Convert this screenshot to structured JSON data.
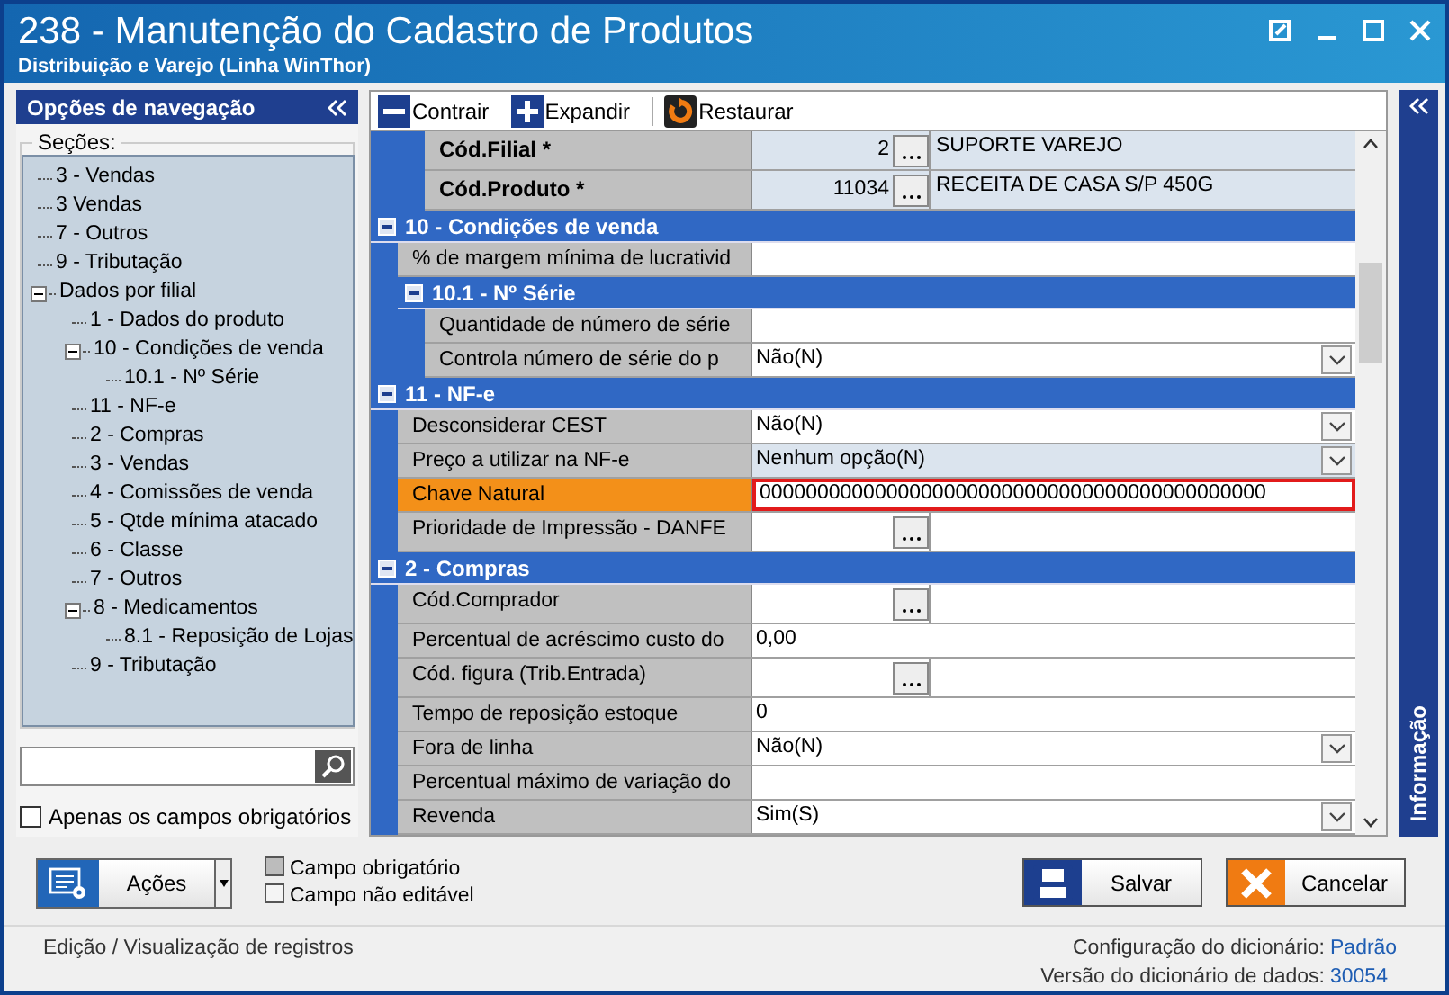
{
  "window": {
    "title": "238 - Manutenção do Cadastro de Produtos",
    "subtitle": "Distribuição e Varejo (Linha WinThor)"
  },
  "navigation": {
    "title": "Opções de navegação",
    "sections_label": "Seções:",
    "tree": [
      {
        "label": "3 - Vendas"
      },
      {
        "label": "3 Vendas"
      },
      {
        "label": "7 - Outros"
      },
      {
        "label": "9 - Tributação"
      },
      {
        "label": "Dados por filial",
        "expanded": true,
        "children": [
          {
            "label": "1 - Dados do produto"
          },
          {
            "label": "10 - Condições de venda",
            "expanded": true,
            "children": [
              {
                "label": "10.1 - Nº Série"
              }
            ]
          },
          {
            "label": "11 - NF-e"
          },
          {
            "label": "2 - Compras"
          },
          {
            "label": "3 - Vendas"
          },
          {
            "label": "4 - Comissões de venda"
          },
          {
            "label": "5 - Qtde mínima atacado"
          },
          {
            "label": "6 - Classe"
          },
          {
            "label": "7 - Outros"
          },
          {
            "label": "8 - Medicamentos",
            "expanded": true,
            "children": [
              {
                "label": "8.1 -  Reposição de Lojas"
              }
            ]
          },
          {
            "label": "9 - Tributação"
          }
        ]
      }
    ],
    "required_only": {
      "label": "Apenas os campos obrigatórios",
      "checked": false
    }
  },
  "toolbar": [
    {
      "kind": "collapse",
      "label": "Contrair"
    },
    {
      "kind": "expand",
      "label": "Expandir"
    },
    {
      "kind": "restore",
      "label": "Restaurar"
    }
  ],
  "grid": {
    "top_rows": [
      {
        "kind": "lookup",
        "label": "Cód.Filial *",
        "code": "2",
        "description": "SUPORTE VAREJO",
        "required": true,
        "editable": false,
        "selected": false
      },
      {
        "kind": "lookup",
        "label": "Cód.Produto *",
        "code": "11034",
        "description": "RECEITA DE CASA S/P 450G",
        "required": true,
        "editable": false,
        "selected": false
      }
    ],
    "sections": [
      {
        "title": "10 - Condições de venda",
        "expanded": true,
        "rows": [
          {
            "kind": "text",
            "label": "% de margem mínima de lucrativid",
            "required": false,
            "editable": true,
            "selected": false
          }
        ],
        "children": [
          {
            "title": "10.1 - Nº Série",
            "expanded": true,
            "rows": [
              {
                "kind": "text",
                "label": "Quantidade de número de série",
                "required": false,
                "editable": true,
                "selected": false
              },
              {
                "kind": "select",
                "label": "Controla número de série do p",
                "value": "Não(N)",
                "required": false,
                "editable": true,
                "selected": false
              }
            ]
          }
        ]
      },
      {
        "title": "11 - NF-e",
        "expanded": true,
        "rows": [
          {
            "kind": "select",
            "label": "Desconsiderar CEST",
            "value": "Não(N)",
            "required": false,
            "editable": true,
            "selected": false
          },
          {
            "kind": "select",
            "label": "Preço a utilizar na NF-e",
            "value": "Nenhum opção(N)",
            "required": false,
            "editable": false,
            "selected": false
          },
          {
            "kind": "text",
            "label": "Chave Natural",
            "value": "00000000000000000000000000000000000000000000",
            "required": false,
            "editable": true,
            "selected": true
          },
          {
            "kind": "lookup",
            "label": "Prioridade de Impressão - DANFE",
            "required": false,
            "editable": true,
            "selected": false
          }
        ]
      },
      {
        "title": "2 - Compras",
        "expanded": true,
        "rows": [
          {
            "kind": "lookup",
            "label": "Cód.Comprador",
            "required": false,
            "editable": true,
            "selected": false
          },
          {
            "kind": "text",
            "label": "Percentual de acréscimo custo do",
            "value": "0,00",
            "required": false,
            "editable": true,
            "selected": false
          },
          {
            "kind": "lookup",
            "label": "Cód. figura (Trib.Entrada)",
            "required": false,
            "editable": true,
            "selected": false
          },
          {
            "kind": "text",
            "label": "Tempo de reposição estoque",
            "value": "0",
            "required": false,
            "editable": true,
            "selected": false
          },
          {
            "kind": "select",
            "label": "Fora de linha",
            "value": "Não(N)",
            "required": false,
            "editable": true,
            "selected": false
          },
          {
            "kind": "text",
            "label": "Percentual máximo de variação do",
            "required": false,
            "editable": true,
            "selected": false
          },
          {
            "kind": "select",
            "label": "Revenda",
            "value": "Sim(S)",
            "required": false,
            "editable": true,
            "selected": false
          }
        ]
      }
    ]
  },
  "info_panel": {
    "title": "Informação"
  },
  "actions_button": {
    "label": "Ações"
  },
  "legend": [
    {
      "label": "Campo obrigatório",
      "color": "#bcbcbc"
    },
    {
      "label": "Campo não editável",
      "color": "#f4f4f4"
    }
  ],
  "buttons": [
    {
      "kind": "save",
      "label": "Salvar"
    },
    {
      "kind": "cancel",
      "label": "Cancelar"
    }
  ],
  "status_bar": {
    "mode": "Edição / Visualização de registros",
    "fields": [
      {
        "label": "Configuração do dicionário:",
        "value": "Padrão"
      },
      {
        "label": "Versão do dicionário de dados:",
        "value": "30054"
      }
    ]
  }
}
